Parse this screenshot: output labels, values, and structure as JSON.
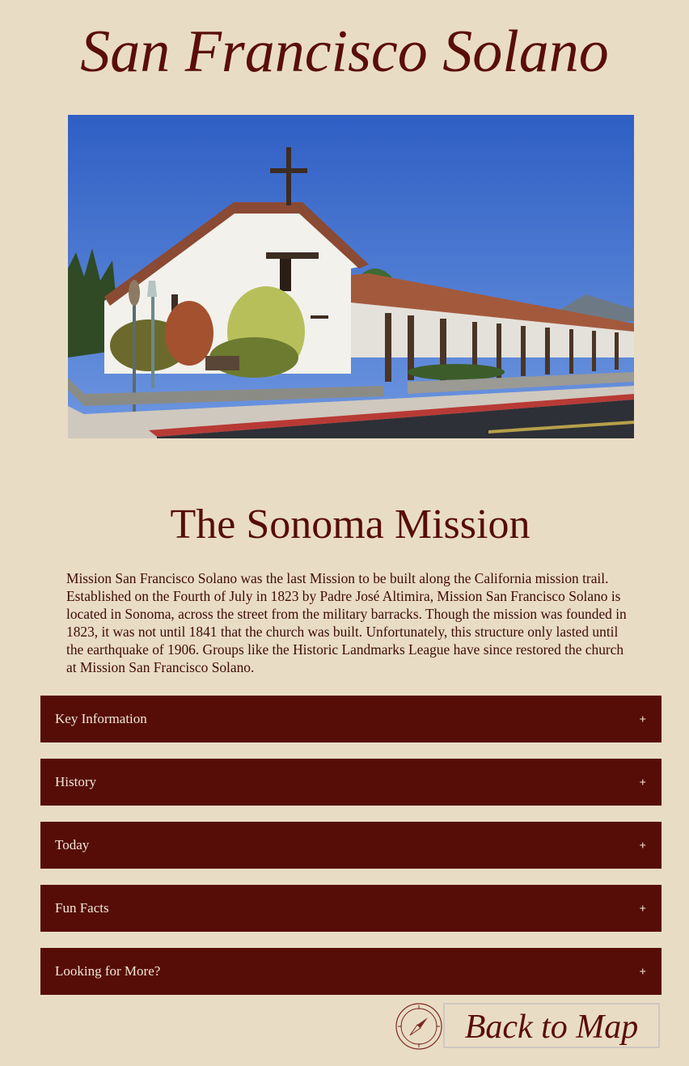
{
  "page": {
    "title": "San Francisco Solano",
    "image_alt": "Mission San Francisco Solano church building"
  },
  "section": {
    "title": "The Sonoma Mission",
    "intro": "Mission San Francisco Solano was the last Mission to be built along the California mission trail. Established on the Fourth of July in 1823 by Padre José Altimira, Mission San Francisco Solano is located in Sonoma, across the street from the military barracks. Though the mission was founded in 1823, it was not until 1841 that the church was built. Unfortunately, this structure only lasted until the earthquake of 1906. Groups like the Historic Landmarks League have since restored the church at Mission San Francisco Solano."
  },
  "accordions": [
    {
      "label": "Key Information",
      "toggle": "+"
    },
    {
      "label": "History",
      "toggle": "+"
    },
    {
      "label": "Today",
      "toggle": "+"
    },
    {
      "label": "Fun Facts",
      "toggle": "+"
    },
    {
      "label": "Looking for More?",
      "toggle": "+"
    }
  ],
  "footer": {
    "back_label": "Back to Map",
    "compass_icon": "compass-icon"
  },
  "colors": {
    "background": "#e9dcc5",
    "accent": "#560d08",
    "accordion_text": "#f3e7d5"
  }
}
